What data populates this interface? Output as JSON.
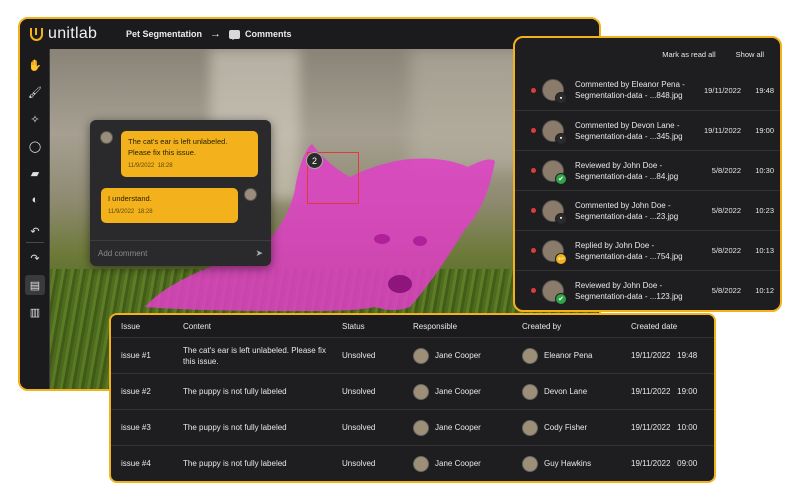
{
  "app": {
    "brand": "unitlab",
    "breadcrumb": {
      "project": "Pet Segmentation",
      "page": "Comments"
    }
  },
  "tools": [
    {
      "icon": "hand-icon",
      "glyph": "✋"
    },
    {
      "icon": "brush-icon",
      "glyph": "🖌"
    },
    {
      "icon": "magic-select-icon",
      "glyph": "✧"
    },
    {
      "icon": "lasso-icon",
      "glyph": "◯"
    },
    {
      "icon": "eraser-icon",
      "glyph": "▰"
    },
    {
      "icon": "contrast-icon",
      "glyph": "◐"
    },
    {
      "icon": "undo-icon",
      "glyph": "↶"
    },
    {
      "icon": "redo-icon",
      "glyph": "↷"
    },
    {
      "icon": "comment-tool-icon",
      "glyph": "▤"
    },
    {
      "icon": "chart-icon",
      "glyph": "▥"
    }
  ],
  "canvas": {
    "marker_number": "2",
    "mask_color": "#e040c8"
  },
  "chat": {
    "messages": [
      {
        "text_line1": "The cat's ear is left unlabeled.",
        "text_line2": "Please fix this issue.",
        "date": "11/9/2022",
        "time": "18:28"
      },
      {
        "text_line1": "I understand.",
        "date": "11/9/2022",
        "time": "18:28"
      }
    ],
    "input_placeholder": "Add comment"
  },
  "notifications": {
    "mark_read": "Mark as read all",
    "show_all": "Show all",
    "items": [
      {
        "line1": "Commented by Eleanor Pena -",
        "line2": "Segmentation-data - ...848.jpg",
        "date": "19/11/2022",
        "time": "19:48",
        "badge_color": "#2b2b2b",
        "badge_glyph": "▪"
      },
      {
        "line1": "Commented by Devon Lane -",
        "line2": "Segmentation-data - ...345.jpg",
        "date": "19/11/2022",
        "time": "19:00",
        "badge_color": "#2b2b2b",
        "badge_glyph": "▪"
      },
      {
        "line1": "Reviewed by John Doe -",
        "line2": "Segmentation-data - ...84.jpg",
        "date": "5/8/2022",
        "time": "10:30",
        "badge_color": "#2fa34a",
        "badge_glyph": "✔"
      },
      {
        "line1": "Commented by John Doe -",
        "line2": "Segmentation-data - ...23.jpg",
        "date": "5/8/2022",
        "time": "10:23",
        "badge_color": "#2b2b2b",
        "badge_glyph": "▪"
      },
      {
        "line1": "Replied by John Doe -",
        "line2": "Segmentation-data - ...754.jpg",
        "date": "5/8/2022",
        "time": "10:13",
        "badge_color": "#f3b21b",
        "badge_glyph": "↩"
      },
      {
        "line1": "Reviewed by John Doe -",
        "line2": "Segmentation-data - ...123.jpg",
        "date": "5/8/2022",
        "time": "10:12",
        "badge_color": "#2fa34a",
        "badge_glyph": "✔"
      }
    ]
  },
  "issues": {
    "headers": [
      "Issue",
      "Content",
      "Status",
      "Responsible",
      "Created by",
      "Created date"
    ],
    "rows": [
      {
        "issue": "issue #1",
        "content": "The cat's ear is left unlabeled. Please fix this issue.",
        "status": "Unsolved",
        "responsible": "Jane Cooper",
        "created_by": "Eleanor Pena",
        "date": "19/11/2022",
        "time": "19:48"
      },
      {
        "issue": "issue #2",
        "content": "The puppy is not fully labeled",
        "status": "Unsolved",
        "responsible": "Jane Cooper",
        "created_by": "Devon Lane",
        "date": "19/11/2022",
        "time": "19:00"
      },
      {
        "issue": "issue #3",
        "content": "The puppy is not fully labeled",
        "status": "Unsolved",
        "responsible": "Jane Cooper",
        "created_by": "Cody Fisher",
        "date": "19/11/2022",
        "time": "10:00"
      },
      {
        "issue": "issue #4",
        "content": "The puppy is not fully labeled",
        "status": "Unsolved",
        "responsible": "Jane Cooper",
        "created_by": "Guy Hawkins",
        "date": "19/11/2022",
        "time": "09:00"
      }
    ]
  }
}
